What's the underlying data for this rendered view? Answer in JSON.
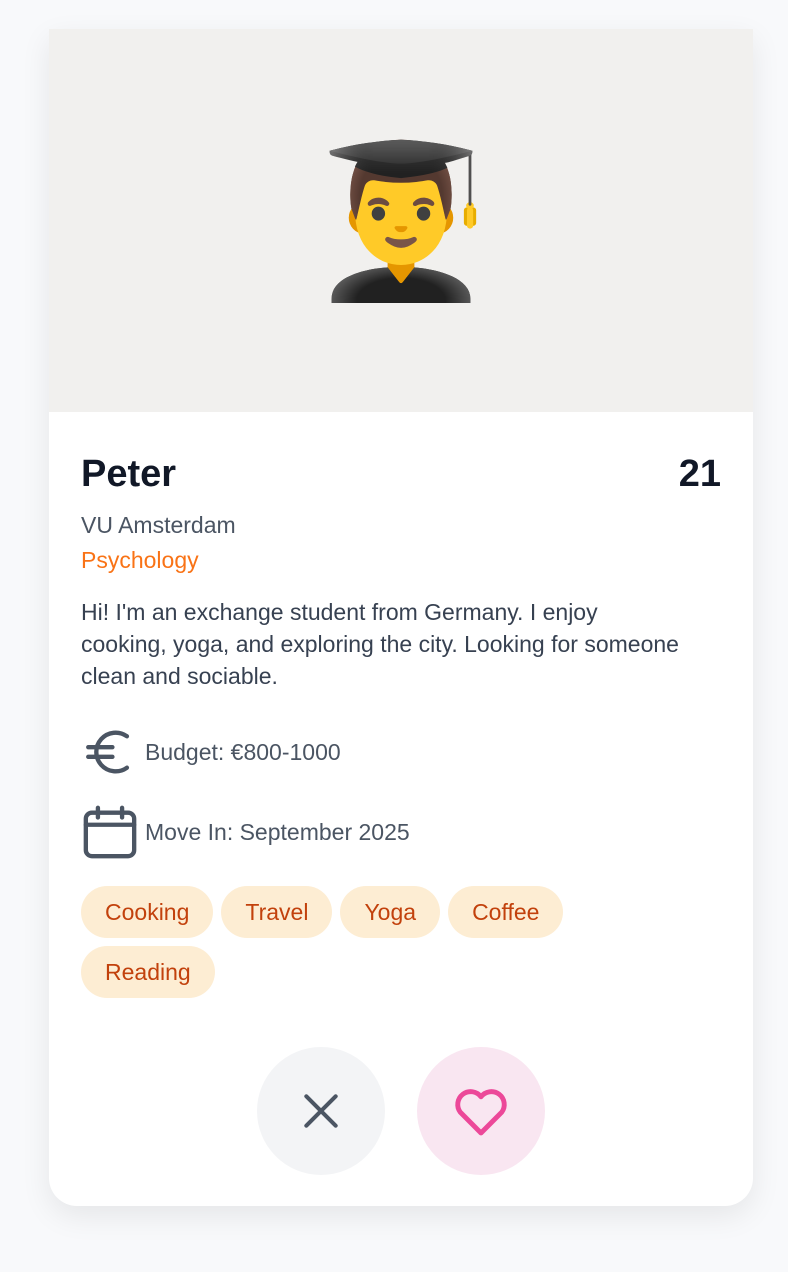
{
  "profile": {
    "avatar_emoji": "👨‍🎓",
    "name": "Peter",
    "age": "21",
    "university": "VU Amsterdam",
    "major": "Psychology",
    "bio": "Hi! I'm an exchange student from Germany. I enjoy cooking, yoga, and exploring the city. Looking for someone clean and sociable.",
    "budget": "Budget: €800-1000",
    "move_in": "Move In: September 2025",
    "tags": [
      "Cooking",
      "Travel",
      "Yoga",
      "Coffee",
      "Reading"
    ]
  },
  "icons": {
    "budget": "euro-icon",
    "move_in": "calendar-icon",
    "pass": "close-icon",
    "like": "heart-icon"
  },
  "colors": {
    "accent": "#f97316",
    "tag_bg": "#fdedd3",
    "tag_text": "#c2410c",
    "like": "#ec4899"
  }
}
